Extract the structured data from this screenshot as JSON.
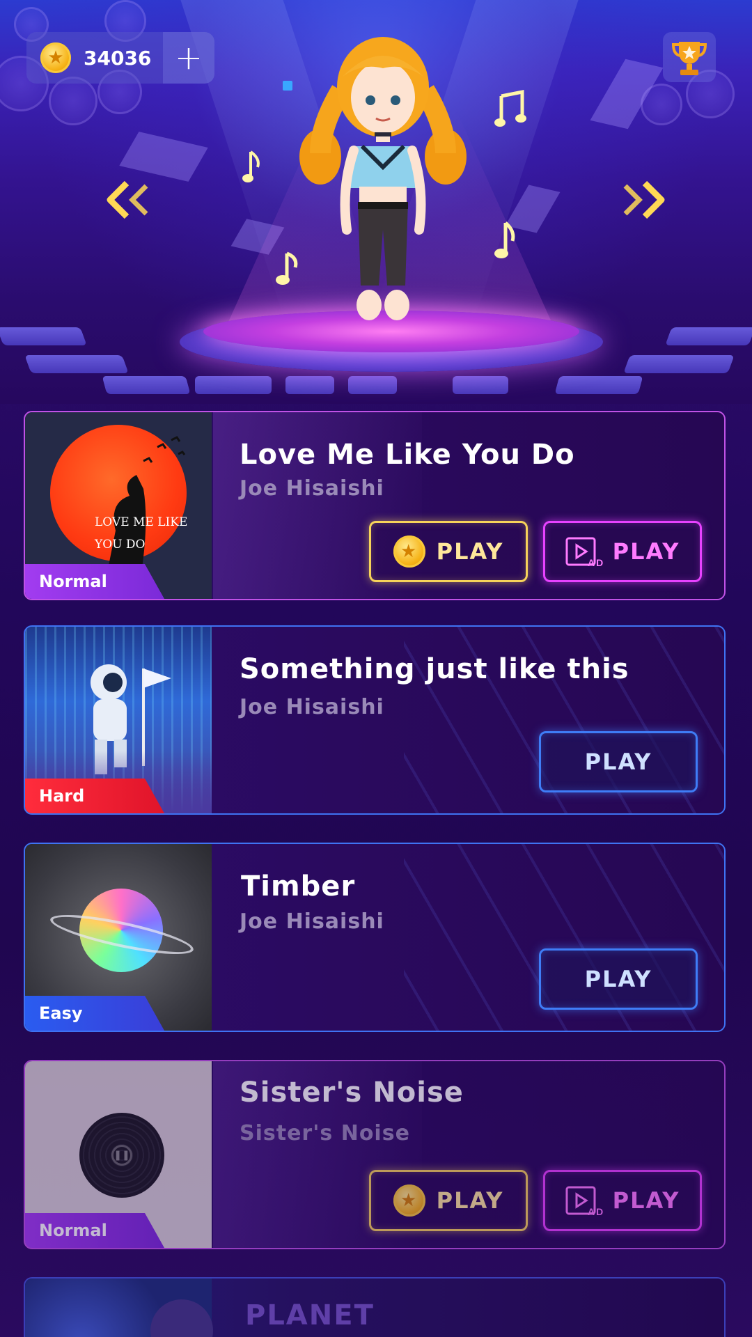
{
  "header": {
    "coins": "34036",
    "add_coins_label": "+"
  },
  "songs": [
    {
      "title": "Love Me Like You Do",
      "artist": "Joe Hisaishi",
      "difficulty": "Normal",
      "cover_text": "LOVE ME LIKE YOU DO",
      "buttons": {
        "coin_play": "PLAY",
        "ad_play": "PLAY",
        "ad_badge": "AD"
      }
    },
    {
      "title": "Something just like this",
      "artist": "Joe Hisaishi",
      "difficulty": "Hard",
      "buttons": {
        "play": "PLAY"
      }
    },
    {
      "title": "Timber",
      "artist": "Joe Hisaishi",
      "difficulty": "Easy",
      "buttons": {
        "play": "PLAY"
      }
    },
    {
      "title": "Sister's Noise",
      "artist": "Sister's Noise",
      "difficulty": "Normal",
      "buttons": {
        "coin_play": "PLAY",
        "ad_play": "PLAY",
        "ad_badge": "AD"
      }
    },
    {
      "title": "PLANET"
    }
  ],
  "colors": {
    "coin_button": "#f7d35a",
    "ad_button": "#e742ff",
    "play_button": "#3f7df7",
    "badge_normal": "#a23cf0",
    "badge_hard": "#ff2c3c",
    "badge_easy": "#2a5cf0"
  },
  "icons": {
    "coin": "coin-icon",
    "plus": "plus-icon",
    "trophy": "trophy-icon",
    "prev": "double-chevron-left-icon",
    "next": "double-chevron-right-icon",
    "ad": "video-ad-icon"
  }
}
